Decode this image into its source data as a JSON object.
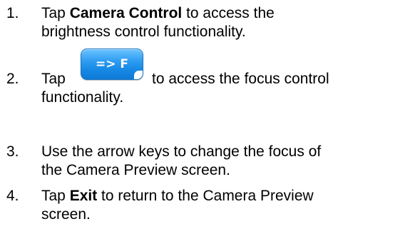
{
  "steps": [
    {
      "number": "1.",
      "pre": "Tap ",
      "bold": "Camera Control",
      "post": " to access the",
      "line2": "brightness control functionality."
    },
    {
      "number": "2.",
      "pre": "Tap",
      "button_label": "=> F",
      "post": "to access the focus control",
      "line2": "functionality."
    },
    {
      "number": "3.",
      "line1": "Use the arrow keys to change the focus of",
      "line2": "the Camera Preview screen."
    },
    {
      "number": "4.",
      "pre": "Tap ",
      "bold": "Exit",
      "post": " to return to the Camera Preview",
      "line2": "screen."
    }
  ],
  "colors": {
    "text": "#000000",
    "button_blue": "#1f8fe8"
  }
}
